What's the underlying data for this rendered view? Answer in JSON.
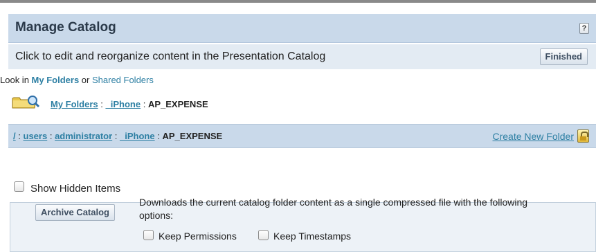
{
  "header": {
    "title": "Manage Catalog",
    "help_icon": "?"
  },
  "subheader": {
    "description": "Click to edit and reorganize content in the Presentation Catalog",
    "finished_label": "Finished"
  },
  "look_in": {
    "prefix": "Look in",
    "my_folders": "My Folders",
    "or": "or",
    "shared_folders": "Shared Folders"
  },
  "current_path": {
    "icon": "folder-search-icon",
    "segments": [
      "My Folders",
      "_iPhone"
    ],
    "current": "AP_EXPENSE",
    "separator": ":"
  },
  "path_bar": {
    "segments": [
      "/",
      "users",
      "administrator",
      "_iPhone"
    ],
    "current": "AP_EXPENSE",
    "separator": ":",
    "create_folder_label": "Create New Folder",
    "create_folder_icon": "lock-icon"
  },
  "show_hidden": {
    "label": "Show Hidden Items",
    "checked": false
  },
  "archive": {
    "button_label": "Archive Catalog",
    "description": "Downloads the current catalog folder content as a single compressed file with the following options:",
    "options": [
      {
        "label": "Keep Permissions",
        "checked": false
      },
      {
        "label": "Keep Timestamps",
        "checked": false
      }
    ]
  },
  "colors": {
    "header_bg": "#c9d9ea",
    "subheader_bg": "#e3ebf3",
    "link": "#2d7fa3"
  }
}
